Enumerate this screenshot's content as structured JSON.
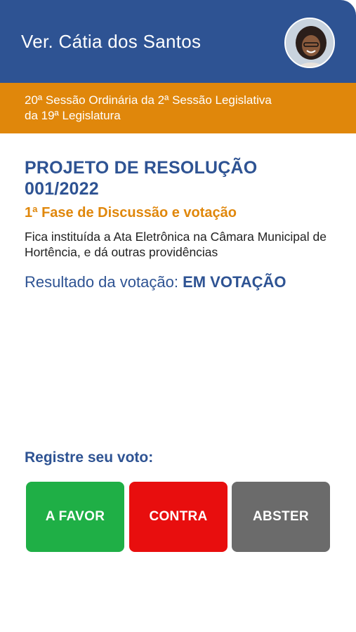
{
  "header": {
    "title": "Ver. Cátia dos Santos",
    "avatar_icon": "user-avatar-photo"
  },
  "session": {
    "line1": "20ª Sessão Ordinária da 2ª Sessão Legislativa",
    "line2": "da 19ª Legislatura"
  },
  "project": {
    "title": "PROJETO DE RESOLUÇÃO 001/2022",
    "phase": "1ª Fase de Discussão e votação",
    "description": "Fica instituída a Ata Eletrônica na Câmara Municipal de Hortência, e dá outras providências",
    "result_label": "Resultado da votação:",
    "result_status": "EM VOTAÇÃO"
  },
  "vote": {
    "label": "Registre seu voto:",
    "favor": "A FAVOR",
    "contra": "CONTRA",
    "abster": "ABSTER"
  },
  "colors": {
    "primary": "#2e5393",
    "accent": "#e0870b",
    "favor": "#1faf46",
    "contra": "#e80e0e",
    "abster": "#6b6b6b"
  }
}
